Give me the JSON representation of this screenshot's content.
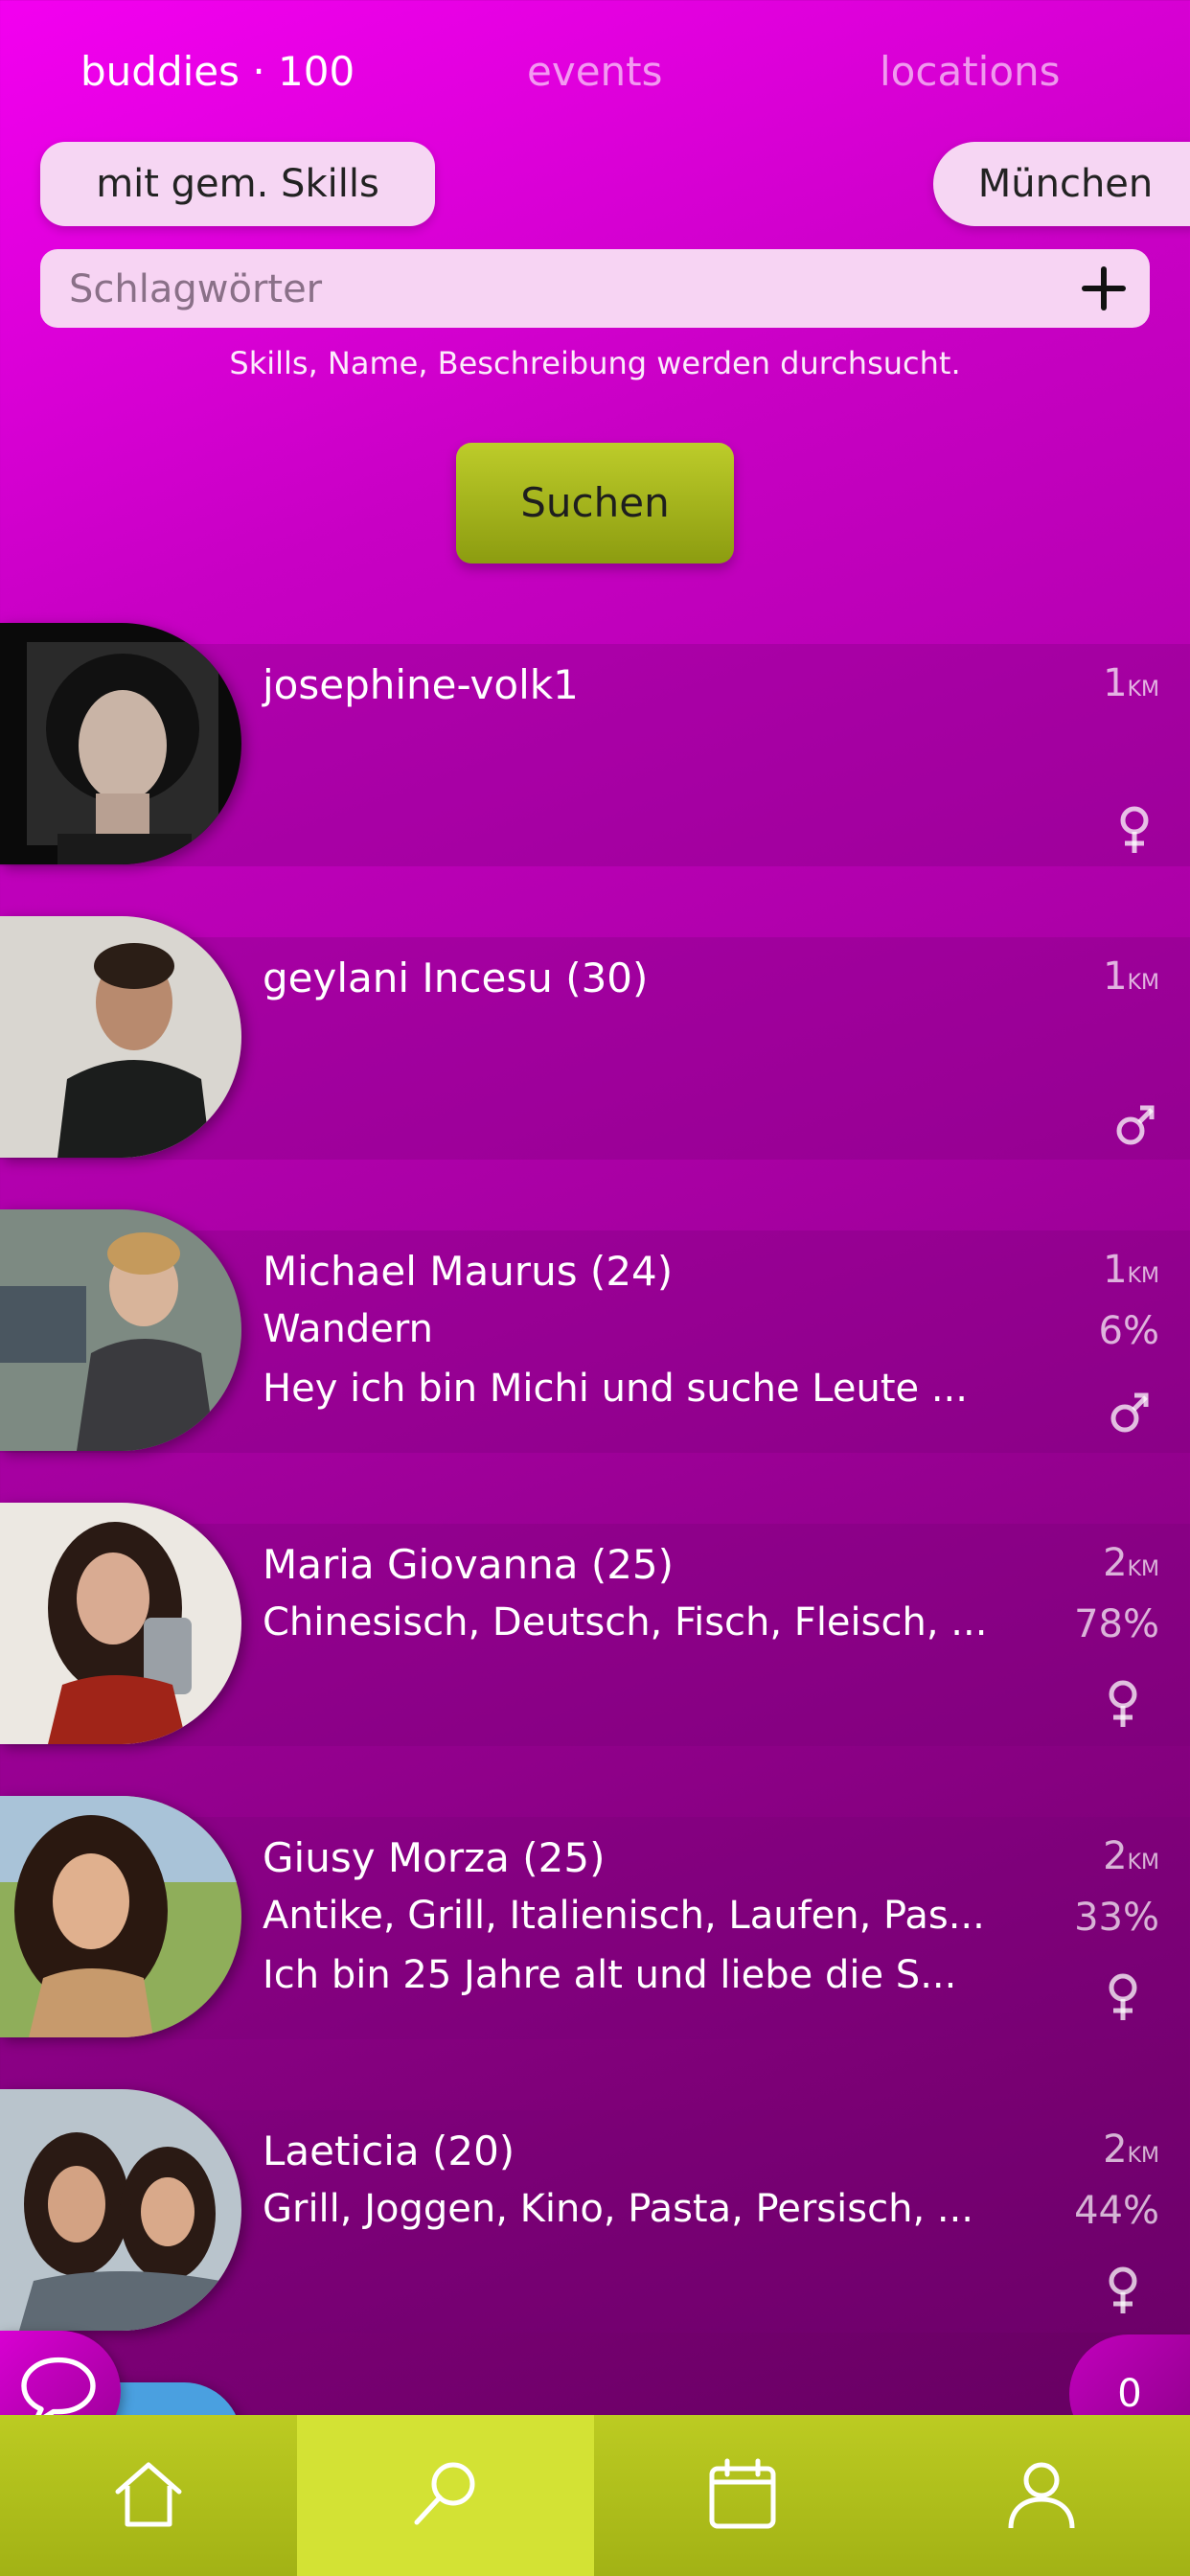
{
  "tabs": [
    {
      "label": "buddies · 100",
      "active": true
    },
    {
      "label": "events",
      "active": false
    },
    {
      "label": "locations",
      "active": false
    }
  ],
  "filters": {
    "skills_chip": "mit gem. Skills",
    "city_chip": "München"
  },
  "search": {
    "placeholder": "Schlagwörter",
    "value": "",
    "hint": "Skills, Name, Beschreibung werden durchsucht.",
    "button_label": "Suchen"
  },
  "buddies": [
    {
      "name": "josephine-volk1",
      "line2": "",
      "line3": "",
      "distance": "1",
      "unit": "KM",
      "match": "",
      "gender": "female"
    },
    {
      "name": "geylani Incesu (30)",
      "line2": "",
      "line3": "",
      "distance": "1",
      "unit": "KM",
      "match": "",
      "gender": "male"
    },
    {
      "name": "Michael Maurus (24)",
      "line2": "Wandern",
      "line3": "Hey ich bin Michi und suche Leute ...",
      "distance": "1",
      "unit": "KM",
      "match": "6%",
      "gender": "male"
    },
    {
      "name": "Maria Giovanna (25)",
      "line2": "Chinesisch, Deutsch, Fisch, Fleisch, ...",
      "line3": "",
      "distance": "2",
      "unit": "KM",
      "match": "78%",
      "gender": "female"
    },
    {
      "name": "Giusy Morza (25)",
      "line2": "Antike, Grill, Italienisch, Laufen, Pas...",
      "line3": "Ich bin 25 Jahre alt und liebe die S...",
      "distance": "2",
      "unit": "KM",
      "match": "33%",
      "gender": "female"
    },
    {
      "name": "Laeticia (20)",
      "line2": "Grill, Joggen, Kino, Pasta, Persisch, ...",
      "line3": "",
      "distance": "2",
      "unit": "KM",
      "match": "44%",
      "gender": "female"
    }
  ],
  "fabs": {
    "chat_icon": "chat-bubble-icon",
    "counter": "0"
  },
  "nav": [
    {
      "icon": "home-icon",
      "active": false
    },
    {
      "icon": "search-icon",
      "active": true
    },
    {
      "icon": "calendar-icon",
      "active": false
    },
    {
      "icon": "profile-icon",
      "active": false
    }
  ],
  "colors": {
    "background_top": "#f300f0",
    "background_bottom": "#5e005a",
    "accent_lime": "#bccb22",
    "chip_bg": "#f6d6f3"
  }
}
